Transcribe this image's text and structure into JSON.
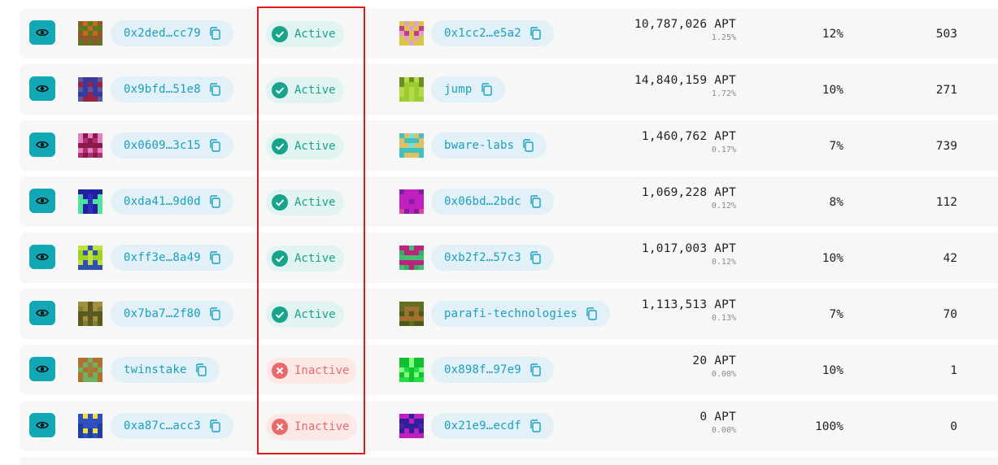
{
  "colors": {
    "eye_button": "#11a7b4",
    "chip_bg": "#e1f1f7",
    "chip_text": "#1a9fbe",
    "active_bg": "#e2f4f1",
    "active_text": "#17a38c",
    "inactive_bg": "#fde8e8",
    "inactive_text": "#e86b6b",
    "highlight_border": "#e01919"
  },
  "icons": {
    "view": "eye-icon",
    "copy": "copy-icon",
    "active": "check-circle-icon",
    "inactive": "x-circle-icon"
  },
  "rows": [
    {
      "validator": "0x2ded…cc79",
      "status": "Active",
      "operator": "0x1cc2…e5a2",
      "stake": "10,787,026 APT",
      "stake_pct": "1.25%",
      "commission": "12%",
      "count": "503"
    },
    {
      "validator": "0x9bfd…51e8",
      "status": "Active",
      "operator": "jump",
      "stake": "14,840,159 APT",
      "stake_pct": "1.72%",
      "commission": "10%",
      "count": "271"
    },
    {
      "validator": "0x0609…3c15",
      "status": "Active",
      "operator": "bware-labs",
      "stake": "1,460,762 APT",
      "stake_pct": "0.17%",
      "commission": "7%",
      "count": "739"
    },
    {
      "validator": "0xda41…9d0d",
      "status": "Active",
      "operator": "0x06bd…2bdc",
      "stake": "1,069,228 APT",
      "stake_pct": "0.12%",
      "commission": "8%",
      "count": "112"
    },
    {
      "validator": "0xff3e…8a49",
      "status": "Active",
      "operator": "0xb2f2…57c3",
      "stake": "1,017,003 APT",
      "stake_pct": "0.12%",
      "commission": "10%",
      "count": "42"
    },
    {
      "validator": "0x7ba7…2f80",
      "status": "Active",
      "operator": "parafi-technologies",
      "stake": "1,113,513 APT",
      "stake_pct": "0.13%",
      "commission": "7%",
      "count": "70"
    },
    {
      "validator": "twinstake",
      "status": "Inactive",
      "operator": "0x898f…97e9",
      "stake": "20 APT",
      "stake_pct": "0.00%",
      "commission": "10%",
      "count": "1"
    },
    {
      "validator": "0xa87c…acc3",
      "status": "Inactive",
      "operator": "0x21e9…ecdf",
      "stake": "0 APT",
      "stake_pct": "0.00%",
      "commission": "100%",
      "count": "0"
    }
  ]
}
